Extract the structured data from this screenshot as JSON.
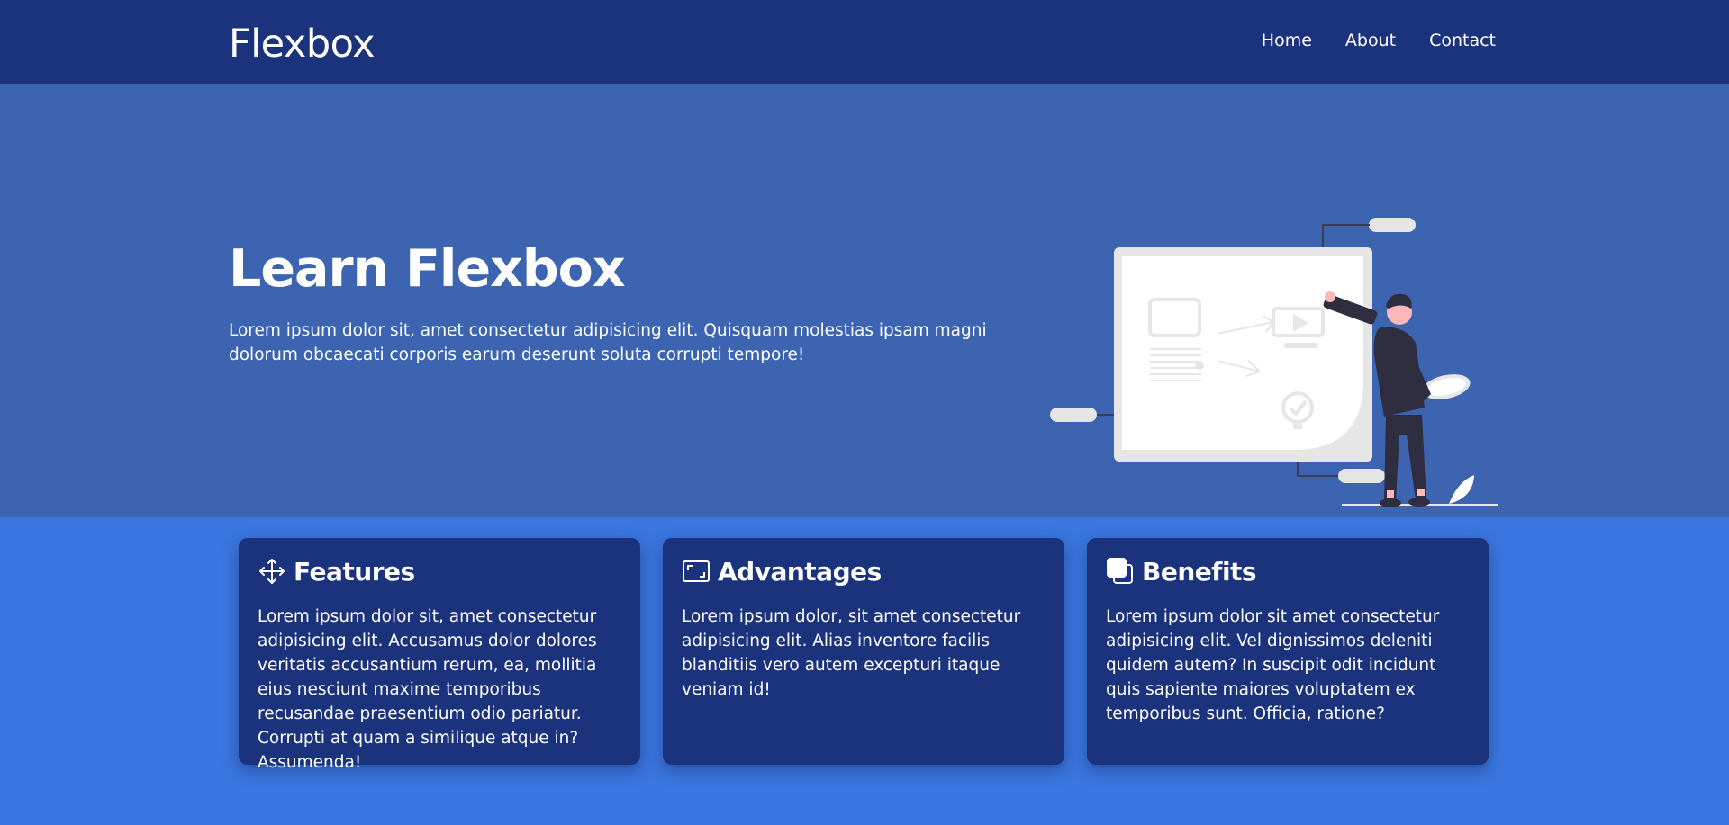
{
  "navbar": {
    "logo": "Flexbox",
    "links": [
      {
        "label": "Home"
      },
      {
        "label": "About"
      },
      {
        "label": "Contact"
      }
    ]
  },
  "showcase": {
    "title": "Learn Flexbox",
    "description": "Lorem ipsum dolor sit, amet consectetur adipisicing elit. Quisquam molestias ipsam magni dolorum obcaecati corporis earum deserunt soluta corrupti tempore!",
    "illustration": "person-presenting-board-illustration"
  },
  "boxes": [
    {
      "icon": "arrows-move-icon",
      "title": "Features",
      "text": "Lorem ipsum dolor sit, amet consectetur adipisicing elit. Accusamus dolor dolores veritatis accusantium rerum, ea, mollitia eius nesciunt maxime temporibus recusandae praesentium odio pariatur. Corrupti at quam a similique atque in? Assumenda!"
    },
    {
      "icon": "expand-screen-icon",
      "title": "Advantages",
      "text": "Lorem ipsum dolor, sit amet consectetur adipisicing elit. Alias inventore facilis blanditiis vero autem excepturi itaque veniam id!"
    },
    {
      "icon": "copy-squares-icon",
      "title": "Benefits",
      "text": "Lorem ipsum dolor sit amet consectetur adipisicing elit. Vel dignissimos deleniti quidem autem? In suscipit odit incidunt quis sapiente maiores voluptatem ex temporibus sunt. Officia, ratione?"
    }
  ],
  "colors": {
    "navbar_bg": "#1b327c",
    "showcase_bg": "#3d64b0",
    "page_bg": "#3b77e0",
    "box_bg": "#1b327c",
    "text": "#ffffff"
  }
}
